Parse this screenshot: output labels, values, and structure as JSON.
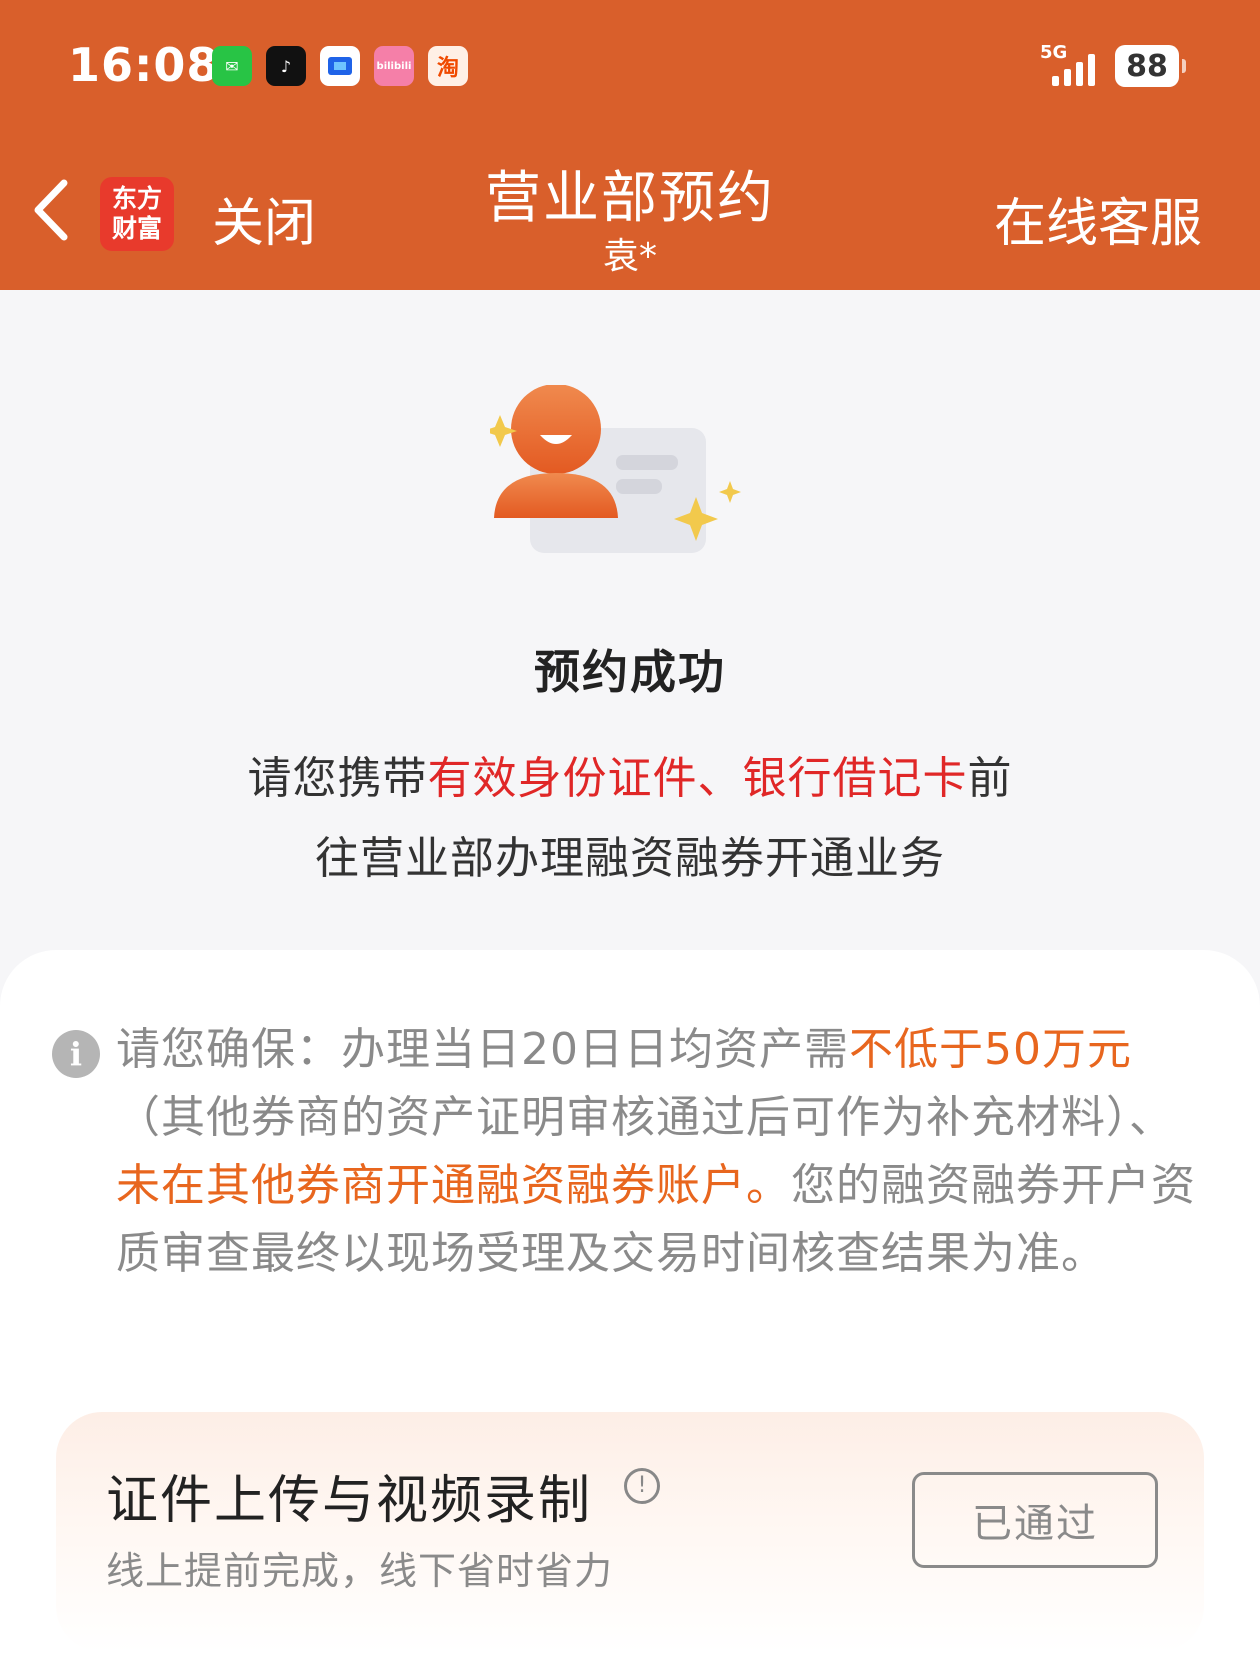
{
  "status_bar": {
    "time": "16:08",
    "network": "5G",
    "battery": "88",
    "apps": [
      {
        "name": "wechat",
        "glyph": "✉"
      },
      {
        "name": "tiktok",
        "glyph": "♪"
      },
      {
        "name": "blue-app",
        "glyph": ""
      },
      {
        "name": "bilibili",
        "glyph": "bilibili"
      },
      {
        "name": "taobao",
        "glyph": "淘"
      }
    ]
  },
  "nav": {
    "logo_line1": "东方",
    "logo_line2": "财富",
    "close_label": "关闭",
    "title": "营业部预约",
    "subtitle": "袁*",
    "service_label": "在线客服"
  },
  "result": {
    "title": "预约成功",
    "line1_prefix": "请您携带",
    "line1_highlight": "有效身份证件、银行借记卡",
    "line1_suffix": "前",
    "line2": "往营业部办理融资融券开通业务"
  },
  "notice": {
    "info_glyph": "i",
    "text_prefix": "请您确保：办理当日20日日均资产需",
    "highlight1": "不低于50万元",
    "text_middle": "（其他券商的资产证明审核通过后可作为补充材料）、",
    "highlight2": "未在其他券商开通融资融券账户。",
    "text_suffix": "您的融资融券开户资质审查最终以现场受理及交易时间核查结果为准。"
  },
  "upload": {
    "title": "证件上传与视频录制",
    "subtitle": "线上提前完成，线下省时省力",
    "status_button": "已通过",
    "info_glyph": "!"
  },
  "colors": {
    "brand": "#d95f2b",
    "highlight_red": "#e02727",
    "highlight_orange": "#e8661e",
    "page_bg": "#f6f6f8"
  }
}
